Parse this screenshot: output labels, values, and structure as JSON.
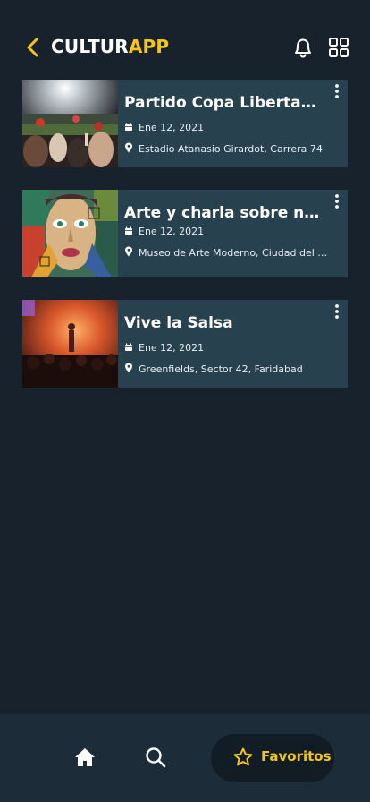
{
  "header": {
    "logo_part1": "CULTUR",
    "logo_part2": "APP",
    "accent": "#f5c518",
    "icons": [
      "back-icon",
      "bell-icon",
      "grid-icon"
    ]
  },
  "events": [
    {
      "title": "Partido Copa Libertadores",
      "date": "Ene 12, 2021",
      "location": "Estadio Atanasio Girardot, Carrera 74"
    },
    {
      "title": "Arte y charla sobre nuevas...",
      "date": "Ene 12, 2021",
      "location": "Museo de Arte Moderno, Ciudad del Rio..."
    },
    {
      "title": "Vive la Salsa",
      "date": "Ene 12, 2021",
      "location": "Greenfields, Sector 42, Faridabad"
    }
  ],
  "bottom_nav": {
    "items": [
      "home-icon",
      "search-icon",
      "star-icon"
    ],
    "active_label": "Favoritos"
  }
}
